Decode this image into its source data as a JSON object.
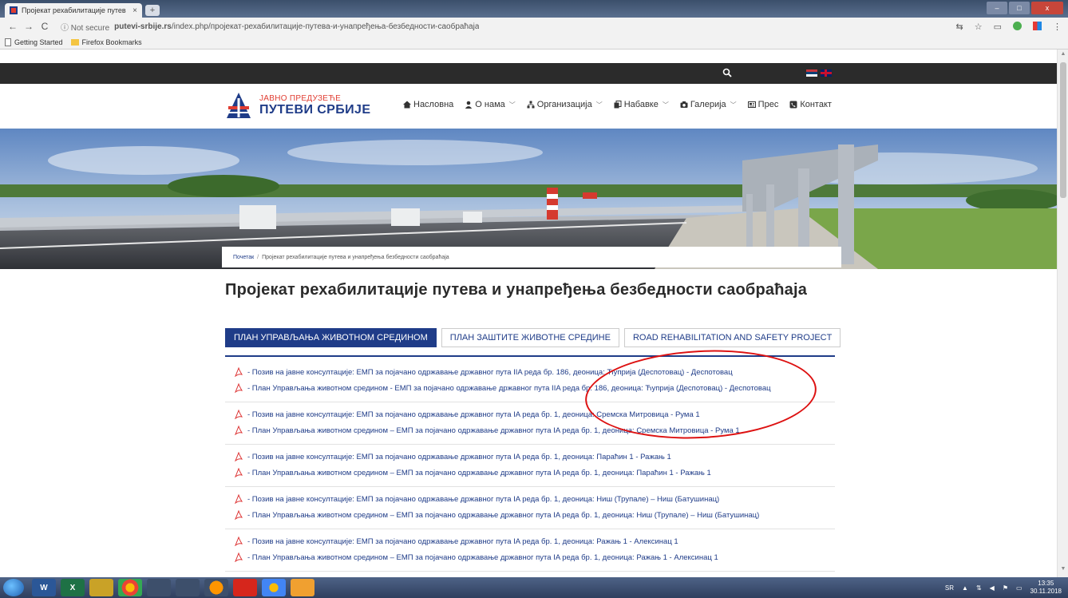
{
  "browser": {
    "tab_title": "Пројекат рехабилитације путев",
    "tab_close": "×",
    "new_tab": "+",
    "window_controls": [
      "–",
      "□",
      "x"
    ],
    "back": "←",
    "forward": "→",
    "reload": "C",
    "security": "ⓘ Not secure",
    "url_domain": "putevi-srbije.rs",
    "url_path": "/index.php/пројекат-рехабилитације-путева-и-унапређења-безбедности-саобраћаја",
    "bookmarks": [
      "Getting Started",
      "Firefox Bookmarks"
    ]
  },
  "site": {
    "brand_small": "ЈАВНО ПРЕДУЗЕЋЕ",
    "brand_big": "ПУТЕВИ СРБИЈЕ",
    "nav": [
      {
        "label": "Насловна",
        "icon": "home-icon",
        "has_dropdown": false
      },
      {
        "label": "О нама",
        "icon": "user-icon",
        "has_dropdown": true
      },
      {
        "label": "Организација",
        "icon": "sitemap-icon",
        "has_dropdown": true
      },
      {
        "label": "Набавке",
        "icon": "copy-icon",
        "has_dropdown": true
      },
      {
        "label": "Галерија",
        "icon": "camera-icon",
        "has_dropdown": true
      },
      {
        "label": "Прес",
        "icon": "newspaper-icon",
        "has_dropdown": false
      },
      {
        "label": "Контакт",
        "icon": "contact-icon",
        "has_dropdown": false
      }
    ],
    "breadcrumb": {
      "home": "Почетак",
      "separator": "/",
      "current": "Пројекат рехабилитације путева и унапређења безбедности саобраћаја"
    },
    "page_title": "Пројекат рехабилитације путева и унапређења безбедности саобраћаја",
    "tabs": [
      {
        "label": "ПЛАН УПРАВЉАЊА ЖИВОТНОМ СРЕДИНОМ",
        "active": true
      },
      {
        "label": "ПЛАН ЗАШТИТЕ ЖИВОТНЕ СРЕДИНЕ",
        "active": false
      },
      {
        "label": "ROAD REHABILITATION AND SAFETY PROJECT",
        "active": false
      }
    ],
    "documents": [
      [
        "- Позив на јавне консултације: ЕМП за појачано одржавање државног пута IIA реда бр. 186, деоница: Ћуприја (Деспотовац) - Деспотовац",
        "- План Управљања животном средином - ЕМП за појачано одржавање државног пута IIA реда бр. 186, деоница: Ћуприја (Деспотовац) - Деспотовац"
      ],
      [
        "- Позив на јавне консултације: ЕМП за појачано одржавање државног пута IA реда бр. 1, деоница: Сремска Митровица - Рума 1",
        "- План Управљања животном средином – ЕМП за појачано одржавање државног пута IA реда бр. 1, деоница: Сремска Митровица - Рума 1"
      ],
      [
        "- Позив на јавне консултације: ЕМП за појачано одржавање државног пута IA реда бр. 1, деоница: Параћин 1 - Ражањ 1",
        "- План Управљања животном средином – ЕМП за појачано одржавање државног пута IA реда бр. 1, деоница: Параћин 1 - Ражањ 1"
      ],
      [
        "- Позив на јавне консултације: ЕМП за појачано одржавање државног пута IA реда бр. 1, деоница: Ниш (Трупале) – Ниш (Батушинац)",
        "- План Управљања животном средином – ЕМП за појачано одржавање државног пута IA реда бр. 1, деоница: Ниш (Трупале) – Ниш (Батушинац)"
      ],
      [
        "- Позив на јавне консултације: ЕМП за појачано одржавање државног пута IA реда бр. 1, деоница: Ражањ 1 - Алексинац 1",
        "- План Управљања животном средином – ЕМП за појачано одржавање државног пута IA реда бр. 1, деоница: Ражањ 1 - Алексинац 1"
      ]
    ]
  },
  "taskbar": {
    "language": "SR",
    "time": "13:35",
    "date": "30.11.2018",
    "apps": [
      "W",
      "X",
      "",
      "",
      "",
      "",
      "",
      "",
      "",
      ""
    ]
  },
  "colors": {
    "brand_blue": "#1f3c88",
    "brand_red": "#e03c31",
    "topbar": "#2b2b2b",
    "annotation_red": "#dd1111"
  }
}
